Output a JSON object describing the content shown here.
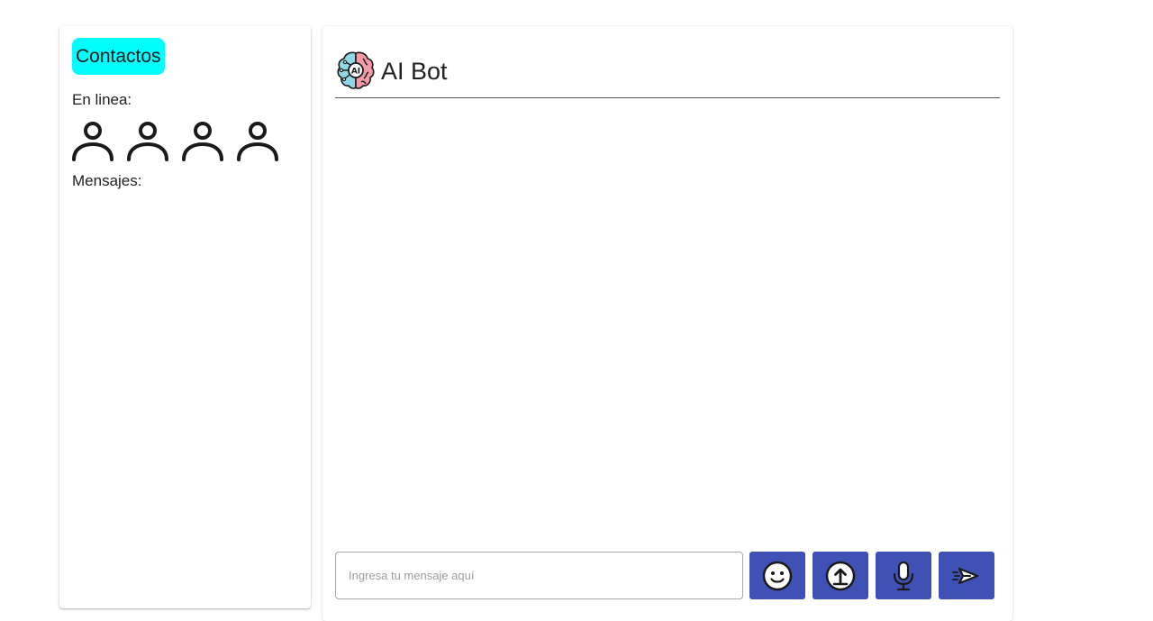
{
  "sidebar": {
    "contacts_button": "Contactos",
    "online_label": "En linea:",
    "online_users": [
      {
        "icon": "user-icon"
      },
      {
        "icon": "user-icon"
      },
      {
        "icon": "user-icon"
      },
      {
        "icon": "user-icon"
      }
    ],
    "messages_label": "Mensajes:"
  },
  "chat": {
    "bot_name": "AI Bot",
    "bot_icon": "ai-brain-icon",
    "messages": [],
    "input": {
      "value": "",
      "placeholder": "Ingresa tu mensaje aquí"
    },
    "actions": [
      {
        "icon": "emoji-icon"
      },
      {
        "icon": "upload-icon"
      },
      {
        "icon": "microphone-icon"
      },
      {
        "icon": "send-icon"
      }
    ]
  },
  "colors": {
    "contacts_button_bg": "#00ffff",
    "action_button_bg": "#3f51b5",
    "header_divider": "#555555"
  }
}
